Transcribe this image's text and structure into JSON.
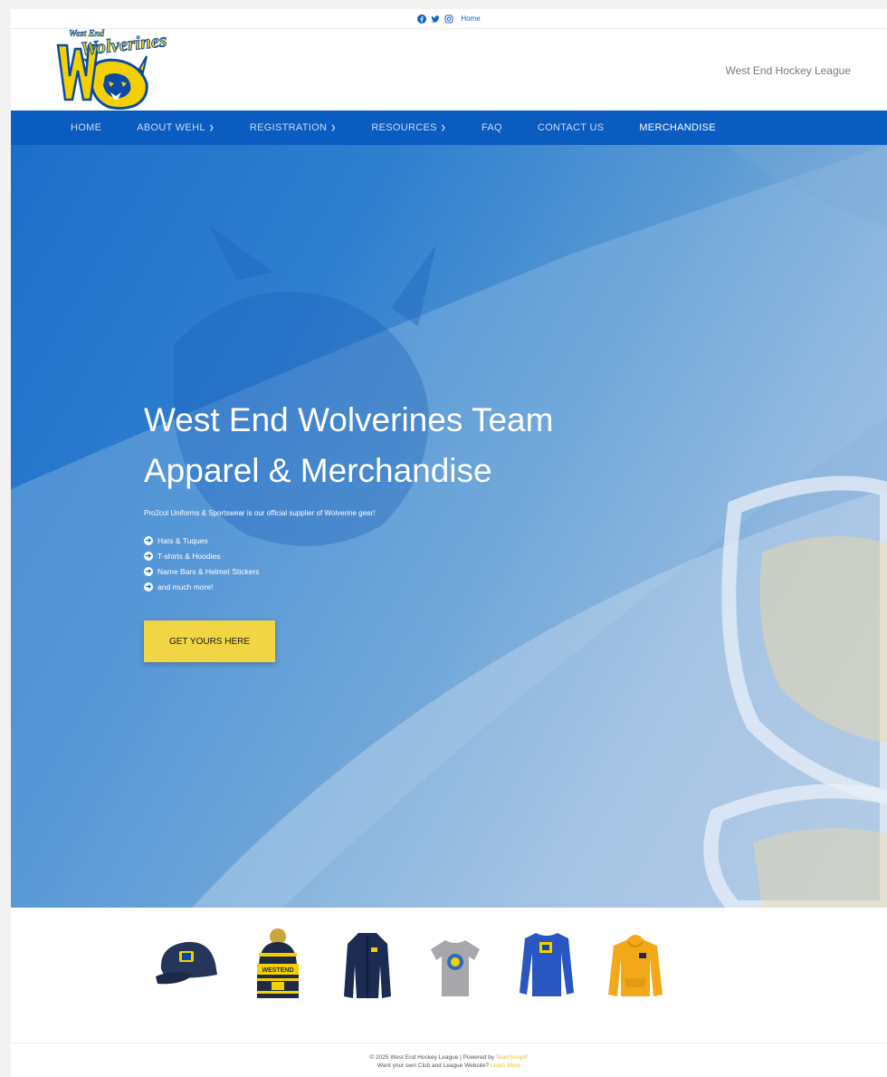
{
  "utility_bar": {
    "icons": [
      "facebook-icon",
      "twitter-icon",
      "instagram-icon"
    ],
    "home_link": "Home"
  },
  "header": {
    "logo_text_top": "West End",
    "logo_text_main": "Wolverines",
    "league_name": "West End Hockey League"
  },
  "nav": {
    "items": [
      {
        "label": "HOME",
        "dropdown": false
      },
      {
        "label": "ABOUT WEHL",
        "dropdown": true
      },
      {
        "label": "REGISTRATION",
        "dropdown": true
      },
      {
        "label": "RESOURCES",
        "dropdown": true
      },
      {
        "label": "FAQ",
        "dropdown": false
      },
      {
        "label": "CONTACT US",
        "dropdown": false
      },
      {
        "label": "MERCHANDISE",
        "dropdown": false,
        "active": true
      }
    ]
  },
  "hero": {
    "title_line1": "West End Wolverines Team",
    "title_line2": "Apparel & Merchandise",
    "subtitle": "Pro2col Uniforms & Sportswear is our official supplier of Wolverine gear!",
    "list": [
      "Hats & Tuques",
      "T-shirts & Hoodies",
      "Name Bars & Helmet Stickers",
      "and much more!"
    ],
    "cta_label": "GET YOURS HERE"
  },
  "products": [
    {
      "name": "cap"
    },
    {
      "name": "tuque",
      "text": "WESTEND"
    },
    {
      "name": "jacket"
    },
    {
      "name": "t-shirt"
    },
    {
      "name": "long-sleeve"
    },
    {
      "name": "hoodie"
    }
  ],
  "footer": {
    "line1_prefix": "© 2025 West End Hockey League | Powered by ",
    "line1_link": "TeamSnap®",
    "line2_prefix": "Want your own Club and League Website? ",
    "line2_link": "Learn More"
  },
  "colors": {
    "nav_bg": "#0b5cc0",
    "cta_bg": "#f1d544",
    "accent_yellow": "#f5d000",
    "link_blue": "#1463c4"
  }
}
